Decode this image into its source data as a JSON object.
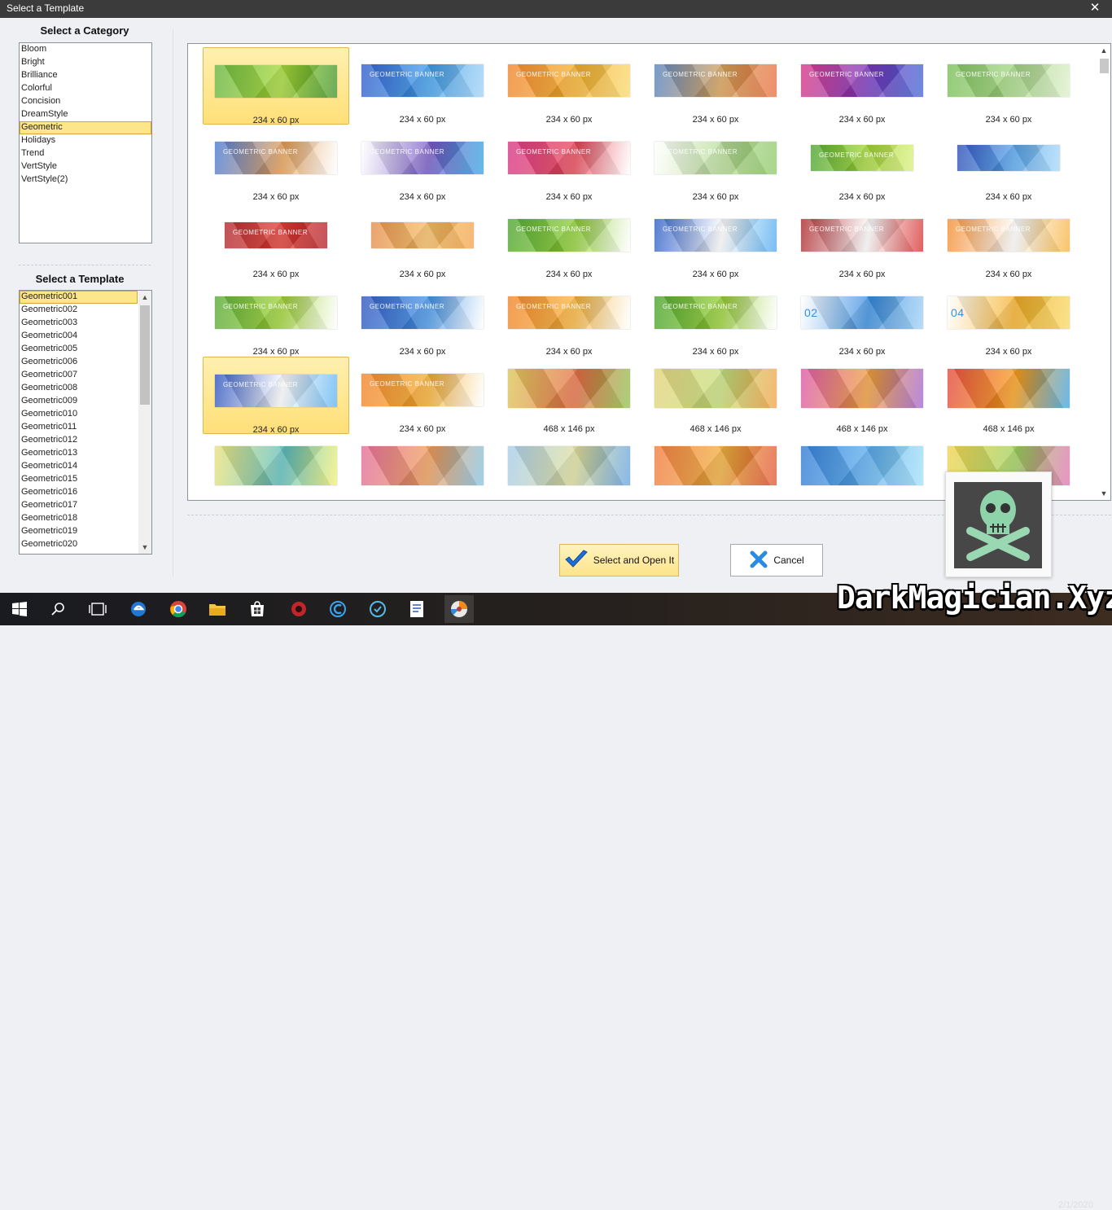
{
  "window": {
    "title": "Select a Template",
    "close_glyph": "✕"
  },
  "category_panel": {
    "title": "Select a Category",
    "items": [
      "Bloom",
      "Bright",
      "Brilliance",
      "Colorful",
      "Concision",
      "DreamStyle",
      "Geometric",
      "Holidays",
      "Trend",
      "VertStyle",
      "VertStyle(2)"
    ],
    "selected": "Geometric"
  },
  "template_panel": {
    "title": "Select a Template",
    "items": [
      "Geometric001",
      "Geometric002",
      "Geometric003",
      "Geometric004",
      "Geometric005",
      "Geometric006",
      "Geometric007",
      "Geometric008",
      "Geometric009",
      "Geometric010",
      "Geometric011",
      "Geometric012",
      "Geometric013",
      "Geometric014",
      "Geometric015",
      "Geometric016",
      "Geometric017",
      "Geometric018",
      "Geometric019",
      "Geometric020"
    ],
    "selected": "Geometric001"
  },
  "gallery": {
    "tiles": [
      {
        "size": "234 x 60 px",
        "colors": [
          "#5aae2a",
          "#a6d93b",
          "#3b8f22"
        ]
      },
      {
        "size": "234 x 60 px",
        "colors": [
          "#1e4fc7",
          "#43a0ec",
          "#9fd2f7"
        ],
        "text": "GEOMETRIC BANNER"
      },
      {
        "size": "234 x 60 px",
        "colors": [
          "#f07a1a",
          "#f6b230",
          "#fbd86a"
        ],
        "text": "GEOMETRIC BANNER"
      },
      {
        "size": "234 x 60 px",
        "colors": [
          "#4977b8",
          "#d9a35a",
          "#e86a3a"
        ],
        "text": "GEOMETRIC BANNER"
      },
      {
        "size": "234 x 60 px",
        "colors": [
          "#d4247a",
          "#7b3ac0",
          "#3b62d3"
        ],
        "text": "GEOMETRIC BANNER"
      },
      {
        "size": "234 x 60 px",
        "colors": [
          "#6fb84a",
          "#a8d888",
          "#dcefc9"
        ],
        "text": "GEOMETRIC BANNER"
      },
      {
        "size": "234 x 60 px",
        "colors": [
          "#3a6fd0",
          "#e6a15a",
          "#ffffff"
        ],
        "text": "GEOMETRIC BANNER"
      },
      {
        "size": "234 x 60 px",
        "colors": [
          "#ffffff",
          "#7a5ec8",
          "#2fa3e0"
        ],
        "text": "GEOMETRIC BANNER"
      },
      {
        "size": "234 x 60 px",
        "colors": [
          "#d4247a",
          "#e84a5a",
          "#ffffff"
        ],
        "text": "GEOMETRIC BANNER"
      },
      {
        "size": "234 x 60 px",
        "colors": [
          "#ffffff",
          "#b8dd98",
          "#8cc866"
        ],
        "text": "GEOMETRIC BANNER"
      },
      {
        "size": "234 x 60 px",
        "colors": [
          "#3d9b1e",
          "#a6d83c",
          "#d8f07a"
        ],
        "text": "GEOMETRIC BANNER"
      },
      {
        "size": "234 x 60 px",
        "colors": [
          "#1b3fb0",
          "#5aa9ef",
          "#a8d8f8"
        ]
      },
      {
        "size": "234 x 60 px",
        "colors": [
          "#a8161a",
          "#e0403a",
          "#b01a20"
        ],
        "text": "GEOMETRIC BANNER"
      },
      {
        "size": "234 x 60 px",
        "colors": [
          "#e2823a",
          "#f6c06a",
          "#f3a247"
        ]
      },
      {
        "size": "234 x 60 px",
        "colors": [
          "#3e9c1c",
          "#92d03a",
          "#ffffff"
        ],
        "text": "GEOMETRIC BANNER"
      },
      {
        "size": "234 x 60 px",
        "colors": [
          "#1a4fc0",
          "#ffffff",
          "#4aa7ef"
        ],
        "text": "GEOMETRIC BANNER"
      },
      {
        "size": "234 x 60 px",
        "colors": [
          "#a5151a",
          "#ffffff",
          "#d62a2a"
        ],
        "text": "GEOMETRIC BANNER"
      },
      {
        "size": "234 x 60 px",
        "colors": [
          "#f2831e",
          "#ffffff",
          "#f6b13a"
        ],
        "text": "GEOMETRIC BANNER"
      },
      {
        "size": "234 x 60 px",
        "colors": [
          "#4aa224",
          "#a2d43a",
          "#ffffff"
        ],
        "text": "GEOMETRIC BANNER"
      },
      {
        "size": "234 x 60 px",
        "colors": [
          "#1b47b8",
          "#4a98e8",
          "#ffffff"
        ],
        "text": "GEOMETRIC BANNER"
      },
      {
        "size": "234 x 60 px",
        "colors": [
          "#f07a16",
          "#f8b640",
          "#ffffff"
        ],
        "text": "GEOMETRIC BANNER"
      },
      {
        "size": "234 x 60 px",
        "colors": [
          "#3a9a1a",
          "#9ad03a",
          "#ffffff"
        ],
        "text": "GEOMETRIC BANNER"
      },
      {
        "size": "234 x 60 px",
        "colors": [
          "#ffffff",
          "#3a8ee0",
          "#9fd0f4"
        ],
        "text": "02"
      },
      {
        "size": "234 x 60 px",
        "colors": [
          "#ffffff",
          "#f4b02a",
          "#f8d860"
        ],
        "text": "04"
      },
      {
        "size": "234 x 60 px",
        "colors": [
          "#1a44b8",
          "#ffffff",
          "#5ab0f0"
        ],
        "text": "GEOMETRIC BANNER"
      },
      {
        "size": "234 x 60 px",
        "colors": [
          "#f07a18",
          "#f6b035",
          "#ffffff"
        ],
        "text": "GEOMETRIC BANNER"
      },
      {
        "size": "468 x 146 px",
        "colors": [
          "#d8c24a",
          "#e8724a",
          "#8cc04a"
        ]
      },
      {
        "size": "468 x 146 px",
        "colors": [
          "#e0d070",
          "#c8e080",
          "#f0a040"
        ]
      },
      {
        "size": "468 x 146 px",
        "colors": [
          "#d84aa0",
          "#f0a040",
          "#a060d0"
        ]
      },
      {
        "size": "468 x 146 px",
        "colors": [
          "#e03a2a",
          "#f8a020",
          "#3aa0e0"
        ]
      },
      {
        "size": "",
        "colors": [
          "#e8e070",
          "#60c0c0",
          "#f0f070"
        ]
      },
      {
        "size": "",
        "colors": [
          "#e06090",
          "#f0a060",
          "#80c0e0"
        ]
      },
      {
        "size": "",
        "colors": [
          "#a0c8e8",
          "#e0e0a0",
          "#60a0e0"
        ]
      },
      {
        "size": "",
        "colors": [
          "#f07030",
          "#f0b040",
          "#e05030"
        ]
      },
      {
        "size": "",
        "colors": [
          "#1e70d0",
          "#60b0f0",
          "#a0e0f8"
        ]
      },
      {
        "size": "",
        "colors": [
          "#f0d040",
          "#a0d060",
          "#e070b0"
        ]
      }
    ]
  },
  "buttons": {
    "primary": "Select and Open It",
    "cancel": "Cancel"
  },
  "taskbar": {
    "watermark": "DarkMagician.Xyz",
    "date": "2/1/2020"
  },
  "icons": {
    "close": "close-icon",
    "check": "check-icon",
    "cancel": "cancel-x-icon"
  }
}
